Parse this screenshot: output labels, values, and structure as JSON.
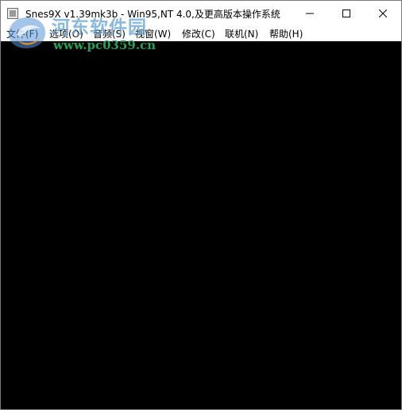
{
  "window": {
    "title": "Snes9X v1.39mk3b - Win95,NT 4.0,及更高版本操作系统"
  },
  "menu": {
    "items": [
      {
        "label": "文件(F)"
      },
      {
        "label": "选项(O)"
      },
      {
        "label": "音频(S)"
      },
      {
        "label": "视窗(W)"
      },
      {
        "label": "修改(C)"
      },
      {
        "label": "联机(N)"
      },
      {
        "label": "帮助(H)"
      }
    ]
  },
  "watermark": {
    "name": "河东软件园",
    "url": "www.pc0359.cn"
  },
  "colors": {
    "game_background": "#000000",
    "titlebar_background": "#ffffff",
    "watermark_blue": "#62a0d7",
    "watermark_green": "#27a05a"
  },
  "icons": {
    "app": "snes9x-app-icon",
    "minimize": "minimize-icon",
    "maximize": "maximize-icon",
    "close": "close-icon"
  }
}
